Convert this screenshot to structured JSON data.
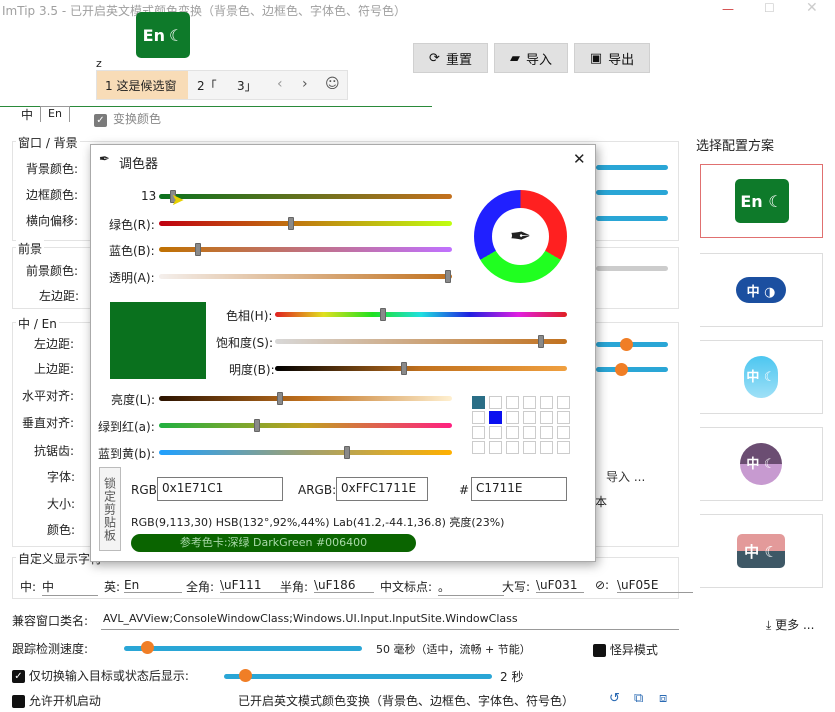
{
  "title": "ImTip 3.5 - 已开启英文模式颜色变换（背景色、边框色、字体色、符号色）",
  "badge": {
    "text": "En",
    "moon": "☾"
  },
  "ime": {
    "input_char": "z",
    "cand_sel": "1 这是候选窗",
    "cand2": "2「",
    "cand3": "3」"
  },
  "toolbar": {
    "reset": "重置",
    "import": "导入",
    "export": "导出"
  },
  "tabs": {
    "zh": "中",
    "en": "En"
  },
  "transform_color": "变换颜色",
  "groups": {
    "window_bg": "窗口 / 背景",
    "foreground": "前景",
    "zh_en": "中 / En",
    "custom": "自定义显示字符"
  },
  "rows": {
    "bg_color": "背景颜色:",
    "border_color": "边框颜色:",
    "h_offset": "横向偏移:",
    "fg_color": "前景颜色:",
    "left_margin_fg": "左边距:",
    "left_margin": "左边距:",
    "top_margin": "上边距:",
    "h_align": "水平对齐:",
    "v_align": "垂直对齐:",
    "antialias": "抗锯齿:",
    "font": "字体:",
    "size": "大小:",
    "color": "颜色:"
  },
  "import_more": "导入 ...",
  "ben": "本",
  "scheme_title": "选择配置方案",
  "dialog": {
    "title": "调色器",
    "red_value": "13",
    "green_label": "绿色(R):",
    "blue_label": "蓝色(B):",
    "alpha_label": "透明(A):",
    "hue_label": "色相(H):",
    "sat_label": "饱和度(S):",
    "light_label": "明度(B):",
    "lum_label": "亮度(L):",
    "g2r_label": "绿到红(a):",
    "b2y_label": "蓝到黄(b):",
    "lock_label": "锁定剪贴板",
    "rgb_label": "RGB:",
    "rgb_value": "0x1E71C1",
    "argb_label": "ARGB:",
    "argb_value": "0xFFC1711E",
    "hash_label": "#",
    "hex_value": "C1711E",
    "info": "RGB(9,113,30) HSB(132°,92%,44%) Lab(41.2,-44.1,36.8) 亮度(23%)",
    "ref_card": "参考色卡:深绿 DarkGreen #006400"
  },
  "custom_chars": [
    {
      "label": "中:",
      "value": "中"
    },
    {
      "label": "英:",
      "value": "En"
    },
    {
      "label": "全角:",
      "value": "\\uF111"
    },
    {
      "label": "半角:",
      "value": "\\uF186"
    },
    {
      "label": "中文标点:",
      "value": "。"
    },
    {
      "label": "大写:",
      "value": "\\uF031"
    },
    {
      "label": "⊘:",
      "value": "\\uF05E"
    }
  ],
  "compat_label": "兼容窗口类名:",
  "compat_value": "AVL_AVView;ConsoleWindowClass;Windows.UI.Input.InputSite.WindowClass",
  "more": "更多 ...",
  "track_label": "跟踪检测速度:",
  "track_value": "50 毫秒（适中，流畅 + 节能）",
  "weird_mode": "怪异模式",
  "switch_label": "仅切换输入目标或状态后显示:",
  "switch_value": "2 秒",
  "autostart": "允许开机启动",
  "status": "已开启英文模式颜色变换（背景色、边框色、字体色、符号色）",
  "scheme_cards": [
    {
      "glyph": "En ☾"
    },
    {
      "glyph": "中 ◑"
    },
    {
      "glyph": "中 ☾"
    },
    {
      "glyph": "中 ☾"
    },
    {
      "glyph": "中 ☾"
    }
  ],
  "colors": {
    "accent": "#0e7a2a",
    "swatch": "#0a711e",
    "orange": "#f07e26",
    "blue": "#2aa6d6"
  }
}
